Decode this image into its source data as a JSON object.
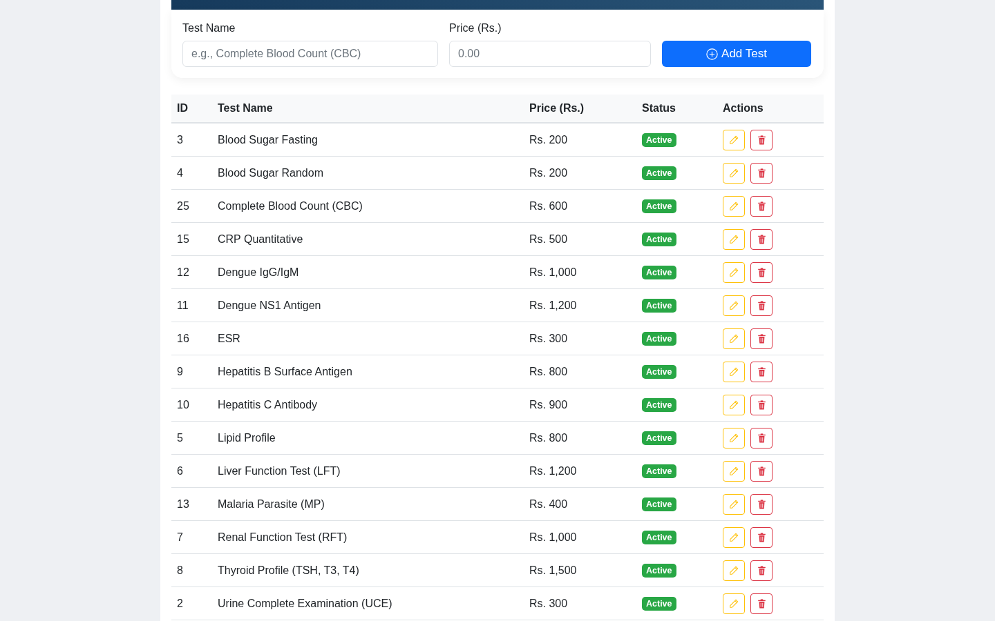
{
  "form": {
    "fields": [
      {
        "label": "Test Name",
        "placeholder": "e.g., Complete Blood Count (CBC)"
      },
      {
        "label": "Price (Rs.)",
        "placeholder": "0.00"
      }
    ],
    "button": "Add Test"
  },
  "table": {
    "columns": [
      "ID",
      "Test Name",
      "Price (Rs.)",
      "Status",
      "Actions"
    ],
    "rows": [
      {
        "id": "3",
        "name": "Blood Sugar Fasting",
        "price": "Rs. 200",
        "status": "Active"
      },
      {
        "id": "4",
        "name": "Blood Sugar Random",
        "price": "Rs. 200",
        "status": "Active"
      },
      {
        "id": "25",
        "name": "Complete Blood Count (CBC)",
        "price": "Rs. 600",
        "status": "Active"
      },
      {
        "id": "15",
        "name": "CRP Quantitative",
        "price": "Rs. 500",
        "status": "Active"
      },
      {
        "id": "12",
        "name": "Dengue IgG/IgM",
        "price": "Rs. 1,000",
        "status": "Active"
      },
      {
        "id": "11",
        "name": "Dengue NS1 Antigen",
        "price": "Rs. 1,200",
        "status": "Active"
      },
      {
        "id": "16",
        "name": "ESR",
        "price": "Rs. 300",
        "status": "Active"
      },
      {
        "id": "9",
        "name": "Hepatitis B Surface Antigen",
        "price": "Rs. 800",
        "status": "Active"
      },
      {
        "id": "10",
        "name": "Hepatitis C Antibody",
        "price": "Rs. 900",
        "status": "Active"
      },
      {
        "id": "5",
        "name": "Lipid Profile",
        "price": "Rs. 800",
        "status": "Active"
      },
      {
        "id": "6",
        "name": "Liver Function Test (LFT)",
        "price": "Rs. 1,200",
        "status": "Active"
      },
      {
        "id": "13",
        "name": "Malaria Parasite (MP)",
        "price": "Rs. 400",
        "status": "Active"
      },
      {
        "id": "7",
        "name": "Renal Function Test (RFT)",
        "price": "Rs. 1,000",
        "status": "Active"
      },
      {
        "id": "8",
        "name": "Thyroid Profile (TSH, T3, T4)",
        "price": "Rs. 1,500",
        "status": "Active"
      },
      {
        "id": "2",
        "name": "Urine Complete Examination (UCE)",
        "price": "Rs. 300",
        "status": "Active"
      }
    ]
  }
}
